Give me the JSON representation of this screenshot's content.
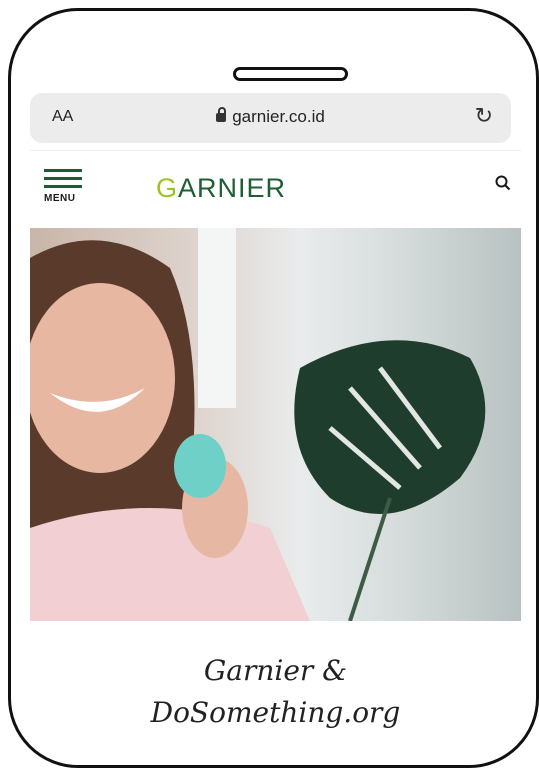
{
  "browser": {
    "text_size_label": "AA",
    "url": "garnier.co.id"
  },
  "site": {
    "menu_label": "MENU",
    "logo_text": "ARNIER",
    "logo_first_letter": "G"
  },
  "hero": {
    "alt": "Woman smiling holding a green Garnier product beside a monstera plant"
  },
  "article": {
    "title_line1": "Garnier &",
    "title_line2": "DoSomething.org"
  },
  "colors": {
    "brand_green": "#1d5e33",
    "logo_lime": "#9cc420"
  }
}
